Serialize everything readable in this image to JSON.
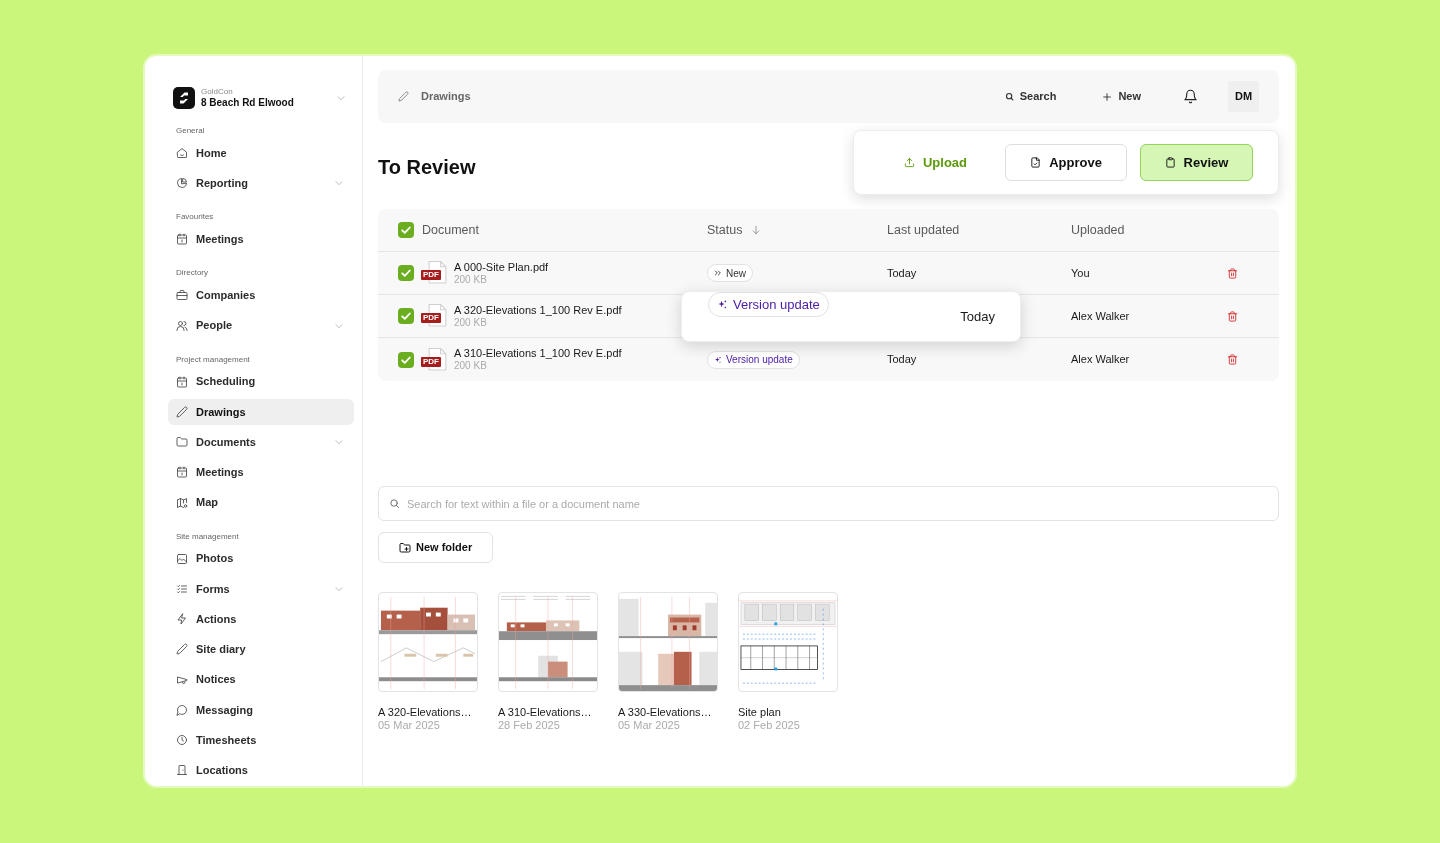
{
  "sidebar": {
    "company": "GoldCon",
    "project": "8 Beach Rd Elwood",
    "sections": [
      {
        "title": "General",
        "items": [
          {
            "label": "Home",
            "selected": false,
            "expandable": false
          },
          {
            "label": "Reporting",
            "selected": false,
            "expandable": true
          }
        ]
      },
      {
        "title": "Favourites",
        "items": [
          {
            "label": "Meetings",
            "selected": false,
            "expandable": false
          }
        ]
      },
      {
        "title": "Directory",
        "items": [
          {
            "label": "Companies",
            "selected": false,
            "expandable": false
          },
          {
            "label": "People",
            "selected": false,
            "expandable": true
          }
        ]
      },
      {
        "title": "Project management",
        "items": [
          {
            "label": "Scheduling",
            "selected": false,
            "expandable": false
          },
          {
            "label": "Drawings",
            "selected": true,
            "expandable": false
          },
          {
            "label": "Documents",
            "selected": false,
            "expandable": true
          },
          {
            "label": "Meetings",
            "selected": false,
            "expandable": false
          },
          {
            "label": "Map",
            "selected": false,
            "expandable": false
          }
        ]
      },
      {
        "title": "Site management",
        "items": [
          {
            "label": "Photos",
            "selected": false,
            "expandable": false
          },
          {
            "label": "Forms",
            "selected": false,
            "expandable": true
          },
          {
            "label": "Actions",
            "selected": false,
            "expandable": false
          },
          {
            "label": "Site diary",
            "selected": false,
            "expandable": false
          },
          {
            "label": "Notices",
            "selected": false,
            "expandable": false
          },
          {
            "label": "Messaging",
            "selected": false,
            "expandable": false
          },
          {
            "label": "Timesheets",
            "selected": false,
            "expandable": false
          },
          {
            "label": "Locations",
            "selected": false,
            "expandable": false
          }
        ]
      }
    ]
  },
  "top_bar": {
    "breadcrumb": "Drawings",
    "search": "Search",
    "new": "New",
    "avatar": "DM"
  },
  "page_title": "To Review",
  "actions": [
    {
      "label": "Upload",
      "kind": "link"
    },
    {
      "label": "Approve",
      "kind": "outline"
    },
    {
      "label": "Review",
      "kind": "primary"
    }
  ],
  "table": {
    "all_checked": true,
    "columns": [
      {
        "label": "Document",
        "sorted": false
      },
      {
        "label": "Status",
        "sorted": true
      },
      {
        "label": "Last updated",
        "sorted": false
      },
      {
        "label": "Uploaded",
        "sorted": false
      }
    ],
    "rows": [
      {
        "checked": true,
        "file_type": "PDF",
        "name": "A 000-Site Plan.pdf",
        "size": "200 KB",
        "status": {
          "kind": "new",
          "label": "New"
        },
        "last_updated": "Today",
        "uploaded": "You"
      },
      {
        "checked": true,
        "file_type": "PDF",
        "name": "A 320-Elevations 1_100 Rev E.pdf",
        "size": "200 KB",
        "uploaded": "Alex Walker"
      },
      {
        "checked": true,
        "file_type": "PDF",
        "name": "A 310-Elevations 1_100 Rev E.pdf",
        "size": "200 KB",
        "status": {
          "kind": "version",
          "label": "Version update"
        },
        "last_updated": "Today",
        "uploaded": "Alex Walker"
      }
    ],
    "floating_row": {
      "status": {
        "kind": "version",
        "label": "Version update"
      },
      "last_updated": "Today"
    }
  },
  "search": {
    "placeholder": "Search for text within a file or a document name"
  },
  "new_folder": "New folder",
  "files": [
    {
      "kind": "elevation",
      "title": "A 320-Elevations…",
      "date": "05 Mar 2025"
    },
    {
      "kind": "elevation",
      "title": "A 310-Elevations…",
      "date": "28 Feb 2025"
    },
    {
      "kind": "elevation",
      "title": "A 330-Elevations…",
      "date": "05 Mar 2025"
    },
    {
      "kind": "plan",
      "title": "Site plan",
      "date": "02 Feb 2025"
    }
  ]
}
